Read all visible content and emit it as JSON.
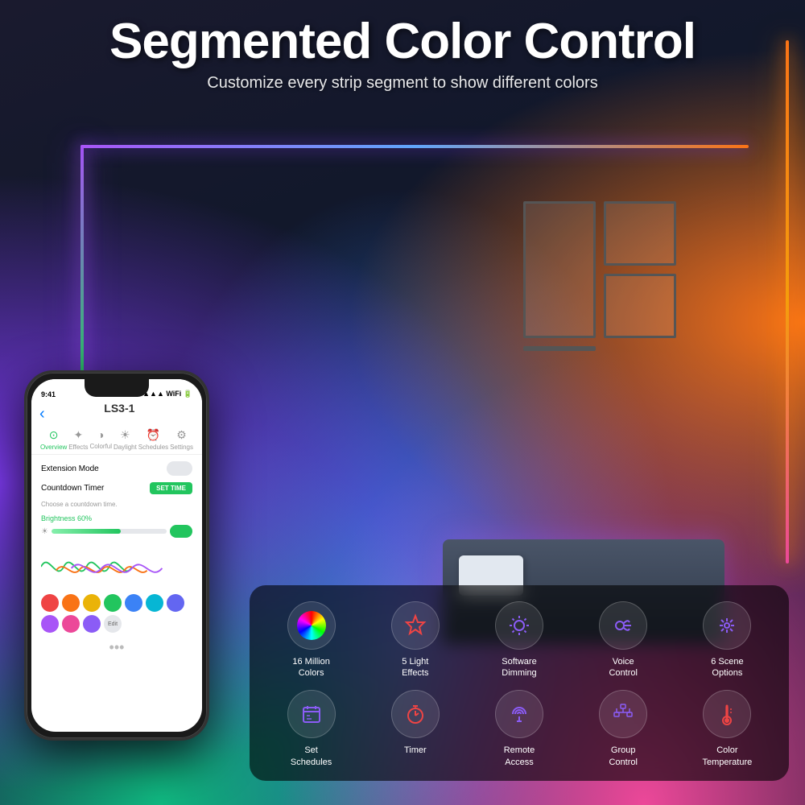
{
  "header": {
    "main_title": "Segmented Color Control",
    "sub_title": "Customize every strip segment to show different colors"
  },
  "phone": {
    "status_time": "9:41",
    "device_name": "LS3-1",
    "tabs": [
      {
        "label": "Overview",
        "icon": "⊙",
        "active": true
      },
      {
        "label": "Effects",
        "icon": "✦"
      },
      {
        "label": "Colorful",
        "icon": "◑"
      },
      {
        "label": "Daylight",
        "icon": "☀"
      },
      {
        "label": "Schedules",
        "icon": "⏰"
      },
      {
        "label": "Settings",
        "icon": "⚙"
      }
    ],
    "extension_mode_label": "Extension Mode",
    "countdown_timer_label": "Countdown Timer",
    "set_time_btn": "SET TIME",
    "choose_hint": "Choose a countdown time.",
    "brightness_label": "Brightness",
    "brightness_percent": "60%"
  },
  "features": [
    {
      "icon": "🎨",
      "type": "color-wheel",
      "label": "16 Million\nColors"
    },
    {
      "icon": "⭐",
      "color": "#ef4444",
      "label": "5 Light\nEffects"
    },
    {
      "icon": "☀",
      "color": "#8b5cf6",
      "label": "Software\nDimming"
    },
    {
      "icon": "🔊",
      "color": "#8b5cf6",
      "label": "Voice\nControl"
    },
    {
      "icon": "🎛",
      "color": "#8b5cf6",
      "label": "6 Scene\nOptions"
    },
    {
      "icon": "📅",
      "color": "#8b5cf6",
      "label": "Set\nSchedules"
    },
    {
      "icon": "⏱",
      "color": "#ef4444",
      "label": "Timer"
    },
    {
      "icon": "📡",
      "color": "#8b5cf6",
      "label": "Remote\nAccess"
    },
    {
      "icon": "🔀",
      "color": "#8b5cf6",
      "label": "Group\nControl"
    },
    {
      "icon": "🌡",
      "color": "#ef4444",
      "label": "Color\nTemperature"
    }
  ],
  "colors": [
    "#ef4444",
    "#f97316",
    "#eab308",
    "#22c55e",
    "#3b82f6",
    "#8b5cf6",
    "#ec4899",
    "#6366f1",
    "#a855f7"
  ]
}
